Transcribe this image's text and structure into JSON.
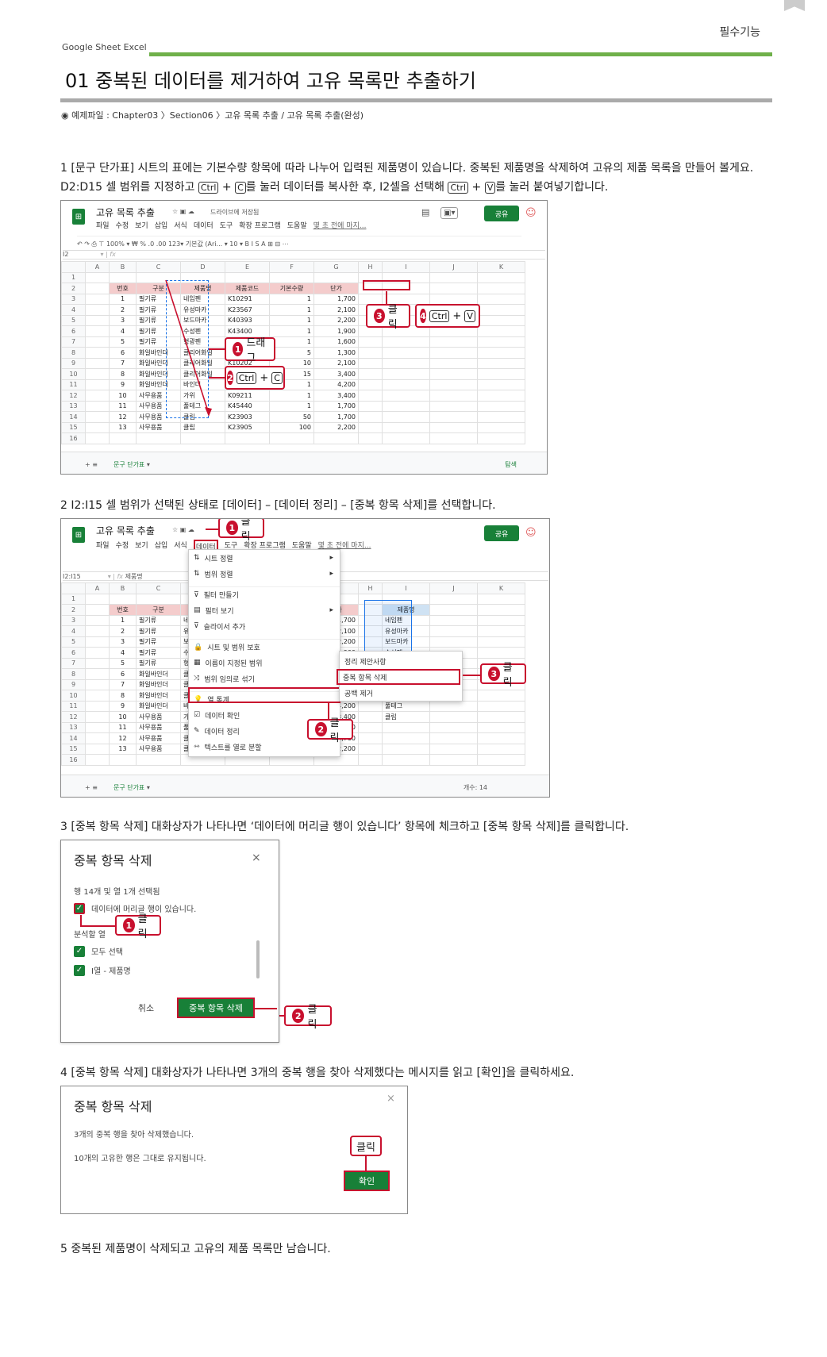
{
  "header": {
    "category": "필수기능",
    "brand": "Google Sheet  Excel",
    "title": "01 중복된 데이터를 제거하여 고유 목록만 추출하기",
    "source": "◉ 예제파일 : Chapter03 〉Section06 〉고유 목록 추출 / 고유 목록 추출(완성)"
  },
  "steps": {
    "s1a": "1 [문구 단가표] 시트의 표에는 기본수량 항목에 따라 나누어 입력된 제품명이 있습니다. 중복된 제품명을 삭제하여 고유의 제품 목록을 만들어 볼게요.",
    "s1b_pre": "D2:D15 셀 범위를 지정하고 ",
    "s1b_mid": "를 눌러 데이터를 복사한 후, I2셀을 선택해 ",
    "s1b_post": "를 눌러 붙여넣기합니다.",
    "s2": "2 I2:I15 셀 범위가 선택된 상태로 [데이터] – [데이터 정리] – [중복 항목 삭제]를 선택합니다.",
    "s3": "3 [중복 항목 삭제] 대화상자가 나타나면 ‘데이터에 머리글 행이 있습니다’ 항목에 체크하고 [중복 항목 삭제]를 클릭합니다.",
    "s4": "4 [중복 항목 삭제] 대화상자가 나타나면 3개의 중복 행을 찾아 삭제했다는 메시지를 읽고 [확인]을 클릭하세요.",
    "s5": "5 중복된 제품명이 삭제되고 고유의 제품 목록만 남습니다."
  },
  "keys": {
    "ctrl": "Ctrl",
    "c": "C",
    "v": "V",
    "plus": "+"
  },
  "sheet": {
    "doc_title": "고유 목록 추출",
    "saved": "드라이브에 저장됨",
    "share": "공유",
    "menus": [
      "파일",
      "수정",
      "보기",
      "삽입",
      "서식",
      "데이터",
      "도구",
      "확장 프로그램",
      "도움말"
    ],
    "last_edit": "몇 초 전에 마지...",
    "toolbar": "100% ▾   ₩  %  .0  .00  123▾   기본값 (Ari... ▾   10   ▾   B  I  S  A",
    "cellref1": "I2",
    "cellref2": "I2:I15",
    "formula2": "제품명",
    "cols": [
      "A",
      "B",
      "C",
      "D",
      "E",
      "F",
      "G",
      "H",
      "I",
      "J",
      "K"
    ],
    "headers": [
      "번호",
      "구분",
      "제품명",
      "제품코드",
      "기본수량",
      "단가"
    ],
    "rows": [
      [
        "1",
        "필기류",
        "네임펜",
        "K10291",
        "1",
        "1,700"
      ],
      [
        "2",
        "필기류",
        "유성마카",
        "K23567",
        "1",
        "2,100"
      ],
      [
        "3",
        "필기류",
        "보드마카",
        "K40393",
        "1",
        "2,200"
      ],
      [
        "4",
        "필기류",
        "수성펜",
        "K43400",
        "1",
        "1,900"
      ],
      [
        "5",
        "필기류",
        "형광펜",
        "K10200",
        "1",
        "1,600"
      ],
      [
        "6",
        "화일바인더",
        "클리어화일",
        "K10201",
        "5",
        "1,300"
      ],
      [
        "7",
        "화일바인더",
        "클리어화일",
        "K10202",
        "10",
        "2,100"
      ],
      [
        "8",
        "화일바인더",
        "클리어화일",
        "K09209",
        "15",
        "3,400"
      ],
      [
        "9",
        "화일바인더",
        "바인더",
        "K09210",
        "1",
        "4,200"
      ],
      [
        "10",
        "사무용품",
        "가위",
        "K09211",
        "1",
        "3,400"
      ],
      [
        "11",
        "사무용품",
        "풀테그",
        "K45440",
        "1",
        "1,700"
      ],
      [
        "12",
        "사무용품",
        "클립",
        "K23903",
        "50",
        "1,700"
      ],
      [
        "13",
        "사무용품",
        "클립",
        "K23905",
        "100",
        "2,200"
      ]
    ],
    "sheet_tab": "문구 단가표",
    "explore": "탐색",
    "count": "개수: 14"
  },
  "callouts1": {
    "drag": "드래그",
    "click3": "클릭"
  },
  "callouts2": {
    "click1": "클릭",
    "click2": "클릭",
    "click3": "클릭"
  },
  "data_menu": {
    "items": [
      "시트 정렬",
      "범위 정렬",
      "필터 만들기",
      "필터 보기",
      "슬라이서 추가",
      "시트 및 범위 보호",
      "이름이 지정된 범위",
      "범위 임의로 섞기",
      "열 통계",
      "데이터 확인",
      "데이터 정리",
      "텍스트를 열로 분할"
    ],
    "sub": [
      "정리 제안사항",
      "중복 항목 삭제",
      "공백 제거"
    ]
  },
  "dialog1": {
    "title": "중복 항목 삭제",
    "info": "행 14개 및 열 1개 선택됨",
    "header_chk": "데이터에 머리글 행이 있습니다.",
    "cols_label": "분석할 열",
    "all": "모두 선택",
    "col": "I열 - 제품명",
    "cancel": "취소",
    "ok": "중복 항목 삭제",
    "click1": "클릭",
    "click2": "클릭"
  },
  "dialog2": {
    "title": "중복 항목 삭제",
    "msg1": "3개의 중복 행을 찾아 삭제했습니다.",
    "msg2": "10개의 고유한 행은 그대로 유지됩니다.",
    "ok": "확인",
    "click": "클릭"
  },
  "colors": {
    "green": "#6fb04a",
    "red": "#c8102e",
    "sheets_green": "#188038"
  }
}
